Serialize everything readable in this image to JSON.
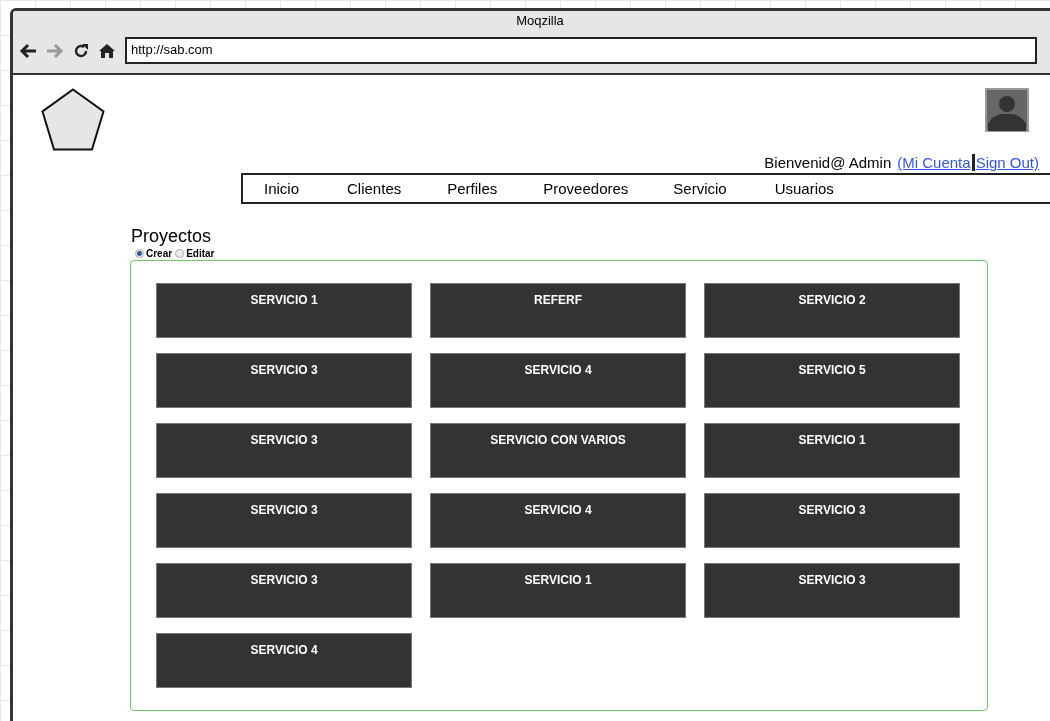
{
  "window": {
    "title": "Moqzilla"
  },
  "address_bar": {
    "url": "http://sab.com"
  },
  "user": {
    "greeting": "Bienvenid@ Admin",
    "links": [
      "(Mi Cuenta",
      "Sign Out)"
    ]
  },
  "nav": [
    "Inicio",
    "Clientes",
    "Perfiles",
    "Proveedores",
    "Servicio",
    "Usuarios"
  ],
  "page": {
    "title": "Proyectos",
    "modes": [
      {
        "label": "Crear",
        "selected": true
      },
      {
        "label": "Editar",
        "selected": false
      }
    ]
  },
  "tiles": [
    "SERVICIO 1",
    "REFERF",
    "SERVICIO 2",
    "SERVICIO 3",
    "SERVICIO 4",
    "SERVICIO 5",
    "SERVICIO 3",
    "SERVICIO CON VARIOS",
    "SERVICIO 1",
    "SERVICIO 3",
    "SERVICIO 4",
    "SERVICIO 3",
    "SERVICIO 3",
    "SERVICIO 1",
    "SERVICIO 3",
    "SERVICIO 4"
  ]
}
